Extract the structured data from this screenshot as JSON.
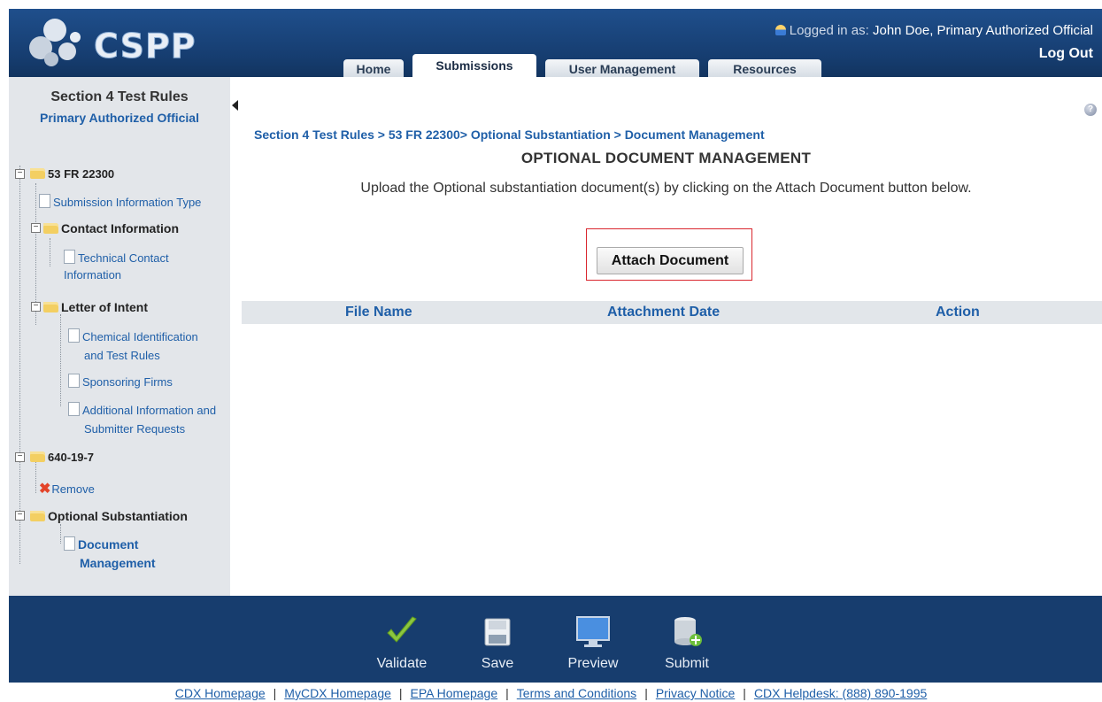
{
  "header": {
    "logo_text": "CSPP",
    "logged_in_prefix": "Logged in as:",
    "user": "John Doe, Primary Authorized Official",
    "logout": "Log Out",
    "tabs": [
      {
        "label": "Home"
      },
      {
        "label": "Submissions",
        "active": true
      },
      {
        "label": "User Management"
      },
      {
        "label": "Resources"
      }
    ]
  },
  "sidebar": {
    "title": "Section 4 Test Rules",
    "subtitle": "Primary Authorized Official",
    "tree": {
      "root": "53 FR 22300",
      "submission_info": "Submission Information Type",
      "contact_info": "Contact Information",
      "technical_contact_1": "Technical Contact",
      "technical_contact_2": "Information",
      "letter_of_intent": "Letter of Intent",
      "chem_id_1": "Chemical Identification",
      "chem_id_2": "and Test Rules",
      "sponsoring": "Sponsoring Firms",
      "additional_1": "Additional Information and",
      "additional_2": "Submitter Requests",
      "cas": "640-19-7",
      "remove": "Remove",
      "optional_sub": "Optional Substantiation",
      "doc_mgmt_1": "Document",
      "doc_mgmt_2": "Management"
    }
  },
  "main": {
    "breadcrumb": "Section 4 Test Rules > 53 FR 22300> Optional Substantiation > Document Management",
    "title": "OPTIONAL DOCUMENT MANAGEMENT",
    "instructions": "Upload the Optional substantiation document(s) by clicking on the Attach Document button below.",
    "attach_button": "Attach Document",
    "table": {
      "columns": [
        "File Name",
        "Attachment Date",
        "Action"
      ],
      "rows": []
    }
  },
  "footer": {
    "actions": [
      {
        "label": "Validate",
        "icon": "checkmark-icon"
      },
      {
        "label": "Save",
        "icon": "save-icon"
      },
      {
        "label": "Preview",
        "icon": "monitor-icon"
      },
      {
        "label": "Submit",
        "icon": "database-submit-icon"
      }
    ],
    "links": [
      "CDX Homepage",
      "MyCDX Homepage",
      "EPA Homepage",
      "Terms and Conditions",
      "Privacy Notice",
      "CDX Helpdesk: (888) 890-1995"
    ]
  },
  "colors": {
    "header_bg": "#1a4679",
    "footer_bg": "#173d6e",
    "link_blue": "#1f5fa8",
    "highlight_red": "#d9262e"
  }
}
